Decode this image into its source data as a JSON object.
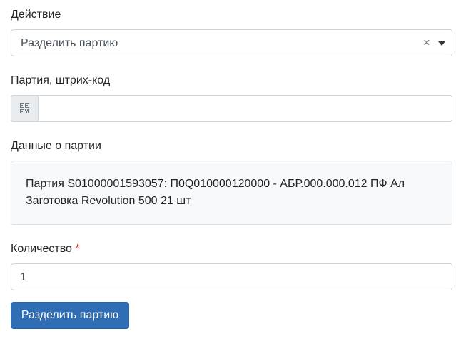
{
  "action": {
    "label": "Действие",
    "selected": "Разделить партию",
    "clear_glyph": "×"
  },
  "barcode": {
    "label": "Партия, штрих-код",
    "value": "",
    "icon": "qr-code-icon"
  },
  "batch_info": {
    "label": "Данные о партии",
    "text": "Партия S01000001593057: П0Q010000120000 - АБР.000.000.012 ПФ Ал Заготовка Revolution 500 21 шт"
  },
  "quantity": {
    "label": "Количество",
    "required_mark": "*",
    "value": "1"
  },
  "submit": {
    "label": "Разделить партию"
  },
  "colors": {
    "primary": "#2f6db5",
    "required": "#dc3545"
  }
}
